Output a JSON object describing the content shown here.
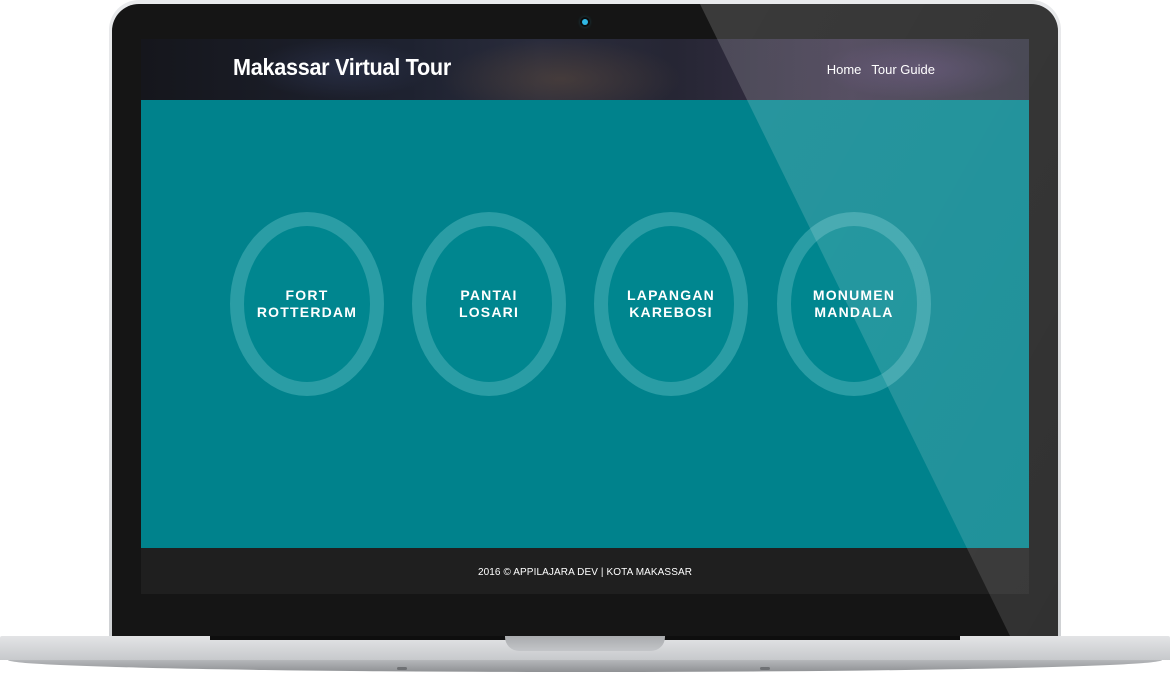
{
  "header": {
    "title": "Makassar Virtual Tour",
    "nav": [
      {
        "label": "Home"
      },
      {
        "label": "Tour Guide"
      }
    ]
  },
  "tours": [
    {
      "line1": "FORT",
      "line2": "ROTTERDAM"
    },
    {
      "line1": "PANTAI",
      "line2": "LOSARI"
    },
    {
      "line1": "LAPANGAN",
      "line2": "KAREBOSI"
    },
    {
      "line1": "MONUMEN",
      "line2": "MANDALA"
    }
  ],
  "footer": {
    "text": "2016 © APPILAJARA DEV | KOTA MAKASSAR"
  },
  "colors": {
    "main_background": "#00828c",
    "circle_ring": "rgba(120,200,205,0.35)",
    "footer_background": "#1f1f1f",
    "camera_light": "#2fb8e6"
  }
}
